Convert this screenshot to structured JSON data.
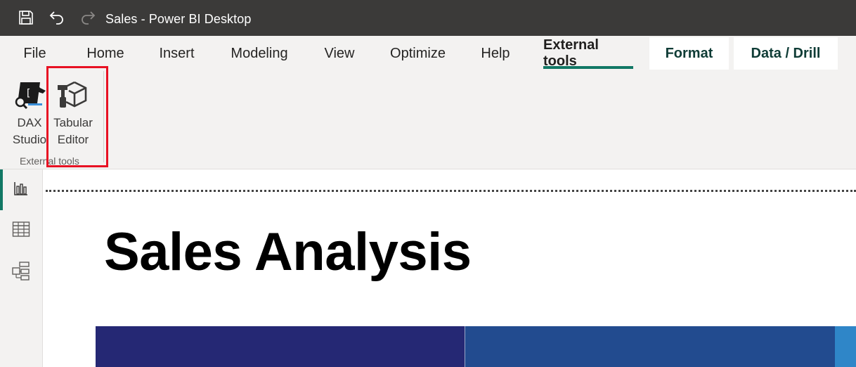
{
  "window": {
    "title": "Sales - Power BI Desktop",
    "icons": [
      "save-icon",
      "undo-icon",
      "redo-icon"
    ]
  },
  "ribbon": {
    "tabs": [
      {
        "label": "File"
      },
      {
        "label": "Home"
      },
      {
        "label": "Insert"
      },
      {
        "label": "Modeling"
      },
      {
        "label": "View"
      },
      {
        "label": "Optimize"
      },
      {
        "label": "Help"
      },
      {
        "label": "External tools",
        "active": true
      },
      {
        "label": "Format"
      },
      {
        "label": "Data / Drill"
      }
    ],
    "group": {
      "label": "External tools",
      "tools": [
        {
          "line1": "DAX",
          "line2": "Studio",
          "icon": "dax-studio-icon"
        },
        {
          "line1": "Tabular",
          "line2": "Editor",
          "icon": "tabular-editor-icon",
          "highlighted": true
        }
      ]
    }
  },
  "leftnav": {
    "items": [
      {
        "icon": "report-view-icon",
        "active": true
      },
      {
        "icon": "table-view-icon"
      },
      {
        "icon": "model-view-icon"
      }
    ]
  },
  "report": {
    "title": "Sales Analysis"
  },
  "colors": {
    "titlebar": "#3b3a39",
    "ribbon": "#f3f2f1",
    "accent": "#117865",
    "highlight": "#e81123",
    "band_dark": "#252874",
    "band_mid": "#224b8f",
    "band_light": "#2f86c8"
  }
}
